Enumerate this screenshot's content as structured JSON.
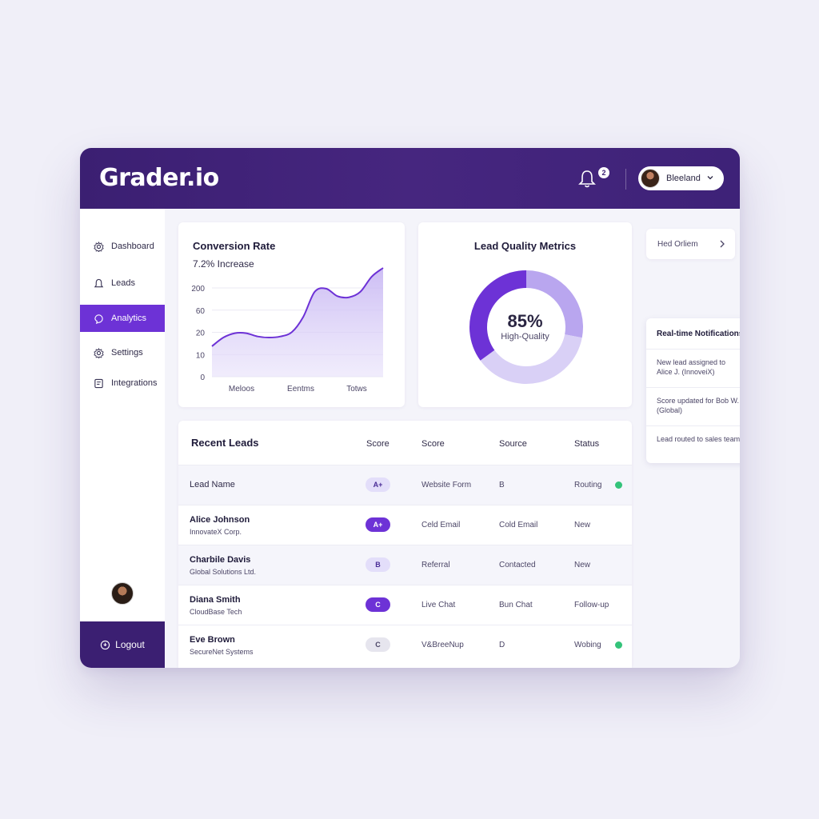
{
  "app": {
    "brand": "Grader.io"
  },
  "header": {
    "notification_count": "2",
    "user_name": "Bleeland"
  },
  "sidebar": {
    "items": [
      {
        "label": "Dashboard",
        "icon": "gear-icon"
      },
      {
        "label": "Leads",
        "icon": "bell-icon"
      },
      {
        "label": "Analytics",
        "icon": "chart-icon"
      },
      {
        "label": "Settings",
        "icon": "gear-icon"
      },
      {
        "label": "Integrations",
        "icon": "plug-icon"
      }
    ],
    "logout_label": "Logout"
  },
  "conversion": {
    "title": "Conversion Rate",
    "subtitle": "7.2% Increase"
  },
  "chart_data": [
    {
      "type": "area",
      "title": "Conversion Rate",
      "y_ticks": [
        "200",
        "60",
        "20",
        "10",
        "0"
      ],
      "x_ticks": [
        "Meloos",
        "Eentms",
        "Totws"
      ],
      "values": [
        0.28,
        0.36,
        0.4,
        0.4,
        0.37,
        0.36,
        0.37,
        0.41,
        0.55,
        0.78,
        0.81,
        0.74,
        0.73,
        0.78,
        0.92,
        1.0
      ],
      "grid": true,
      "color": "#6d32d6"
    },
    {
      "type": "pie",
      "title": "Lead Quality Metrics",
      "center_value": "85%",
      "center_label": "High-Quality",
      "slices": [
        {
          "value": 28,
          "color": "#b9a6ef"
        },
        {
          "value": 37,
          "color": "#d9d0f6"
        },
        {
          "value": 35,
          "color": "#6d32d6"
        }
      ]
    }
  ],
  "side_cards": {
    "hed": "Hed Orliem",
    "notifications": {
      "title": "Real-time Notifications",
      "items": [
        "New lead assigned to Alice J. (InnoveiX)",
        "Score updated for Bob W. (Global)",
        "Lead routed to sales team"
      ]
    }
  },
  "leads": {
    "title": "Recent Leads",
    "columns": [
      "Score",
      "Score",
      "Source",
      "Status"
    ],
    "rows": [
      {
        "name": "Lead Name",
        "company": "",
        "badge": "A+",
        "badge_style": "soft",
        "col2": "Website Form",
        "col3": "B",
        "status": "Routing",
        "dot": true
      },
      {
        "name": "Alice Johnson",
        "company": "InnovateX Corp.",
        "badge": "A+",
        "badge_style": "solid",
        "col2": "Celd Email",
        "col3": "Cold Email",
        "status": "New",
        "dot": false
      },
      {
        "name": "Charbile Davis",
        "company": "Global Solutions Ltd.",
        "badge": "B",
        "badge_style": "soft",
        "col2": "Referral",
        "col3": "Contacted",
        "status": "New",
        "dot": false
      },
      {
        "name": "Diana Smith",
        "company": "CloudBase Tech",
        "badge": "C",
        "badge_style": "solid",
        "col2": "Live Chat",
        "col3": "Bun Chat",
        "status": "Follow-up",
        "dot": false
      },
      {
        "name": "Eve Brown",
        "company": "SecureNet Systems",
        "badge": "C",
        "badge_style": "gray",
        "col2": "V&BreeNup",
        "col3": "D",
        "status": "Wobing",
        "dot": true
      }
    ]
  }
}
